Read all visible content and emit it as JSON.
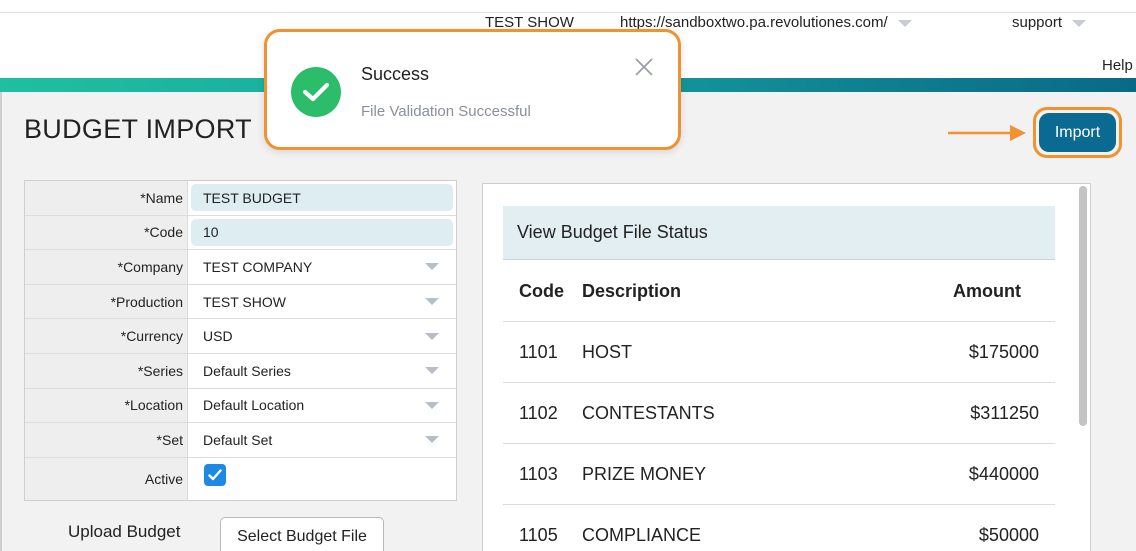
{
  "topbar": {
    "show": "TEST SHOW",
    "url": "https://sandboxtwo.pa.revolutiones.com/",
    "user": "support",
    "help": "Help"
  },
  "page": {
    "title": "BUDGET IMPORT",
    "import_label": "Import"
  },
  "toast": {
    "title": "Success",
    "message": "File Validation Successful"
  },
  "form": {
    "name_label": "*Name",
    "name_value": "TEST BUDGET",
    "code_label": "*Code",
    "code_value": "10",
    "company_label": "*Company",
    "company_value": "TEST COMPANY",
    "production_label": "*Production",
    "production_value": "TEST SHOW",
    "currency_label": "*Currency",
    "currency_value": "USD",
    "series_label": "*Series",
    "series_value": "Default Series",
    "location_label": "*Location",
    "location_value": "Default Location",
    "set_label": "*Set",
    "set_value": "Default Set",
    "active_label": "Active",
    "active_checked": true
  },
  "upload": {
    "label": "Upload Budget",
    "button": "Select Budget File"
  },
  "status": {
    "heading": "View Budget File Status",
    "columns": {
      "code": "Code",
      "description": "Description",
      "amount": "Amount"
    },
    "rows": [
      {
        "code": "1101",
        "description": "HOST",
        "amount": "$175000"
      },
      {
        "code": "1102",
        "description": "CONTESTANTS",
        "amount": "$311250"
      },
      {
        "code": "1103",
        "description": "PRIZE MONEY",
        "amount": "$440000"
      },
      {
        "code": "1105",
        "description": "COMPLIANCE",
        "amount": "$50000"
      }
    ]
  },
  "colors": {
    "accent": "#0a6a92",
    "highlight": "#f0922f",
    "success": "#2bbd6a",
    "input_bg": "#deedf2"
  }
}
